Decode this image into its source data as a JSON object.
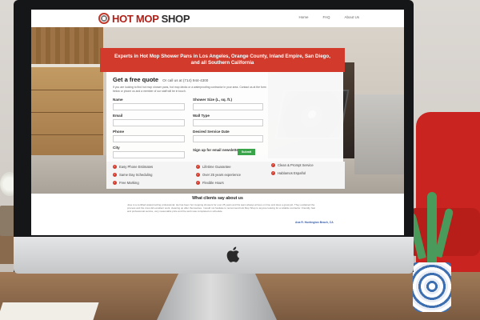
{
  "header": {
    "logo_hot": "HOT MOP",
    "logo_shop": "SHOP",
    "nav": [
      "Home",
      "FAQ",
      "About Us"
    ]
  },
  "hero": {
    "headline": "Experts in Hot Mop Shower Pans in Los Angeles, Orange County, Inland Empire, San Diego, and all Southern California"
  },
  "quote_form": {
    "title": "Get a free quote",
    "call": "Or call us at (714) 944-4300",
    "description": "If you are looking to find hot mop shower pans, hot mop decks or a waterproofing contractor in your area. Contact us at the form below or phone us and a member of our staff will be in touch.",
    "fields": {
      "name": "Name",
      "email": "Email",
      "phone": "Phone",
      "city": "City",
      "shower_size": "Shower Size (L, sq. ft.)",
      "wall_type": "Wall Type",
      "desired_date": "Desired Service Date"
    },
    "signup": "Sign up for email newsletter",
    "submit": "Submit"
  },
  "features": [
    "Easy Phone Estimates",
    "Lifetime Guarantee",
    "Clean & Prompt Service",
    "Same Day Scheduling",
    "Over 25 years experience",
    "Hablamos Español",
    "Free Marking",
    "Flexible Hours"
  ],
  "reviews": {
    "title": "What clients say about us",
    "text": "Jose is a certified waterproofing professional. He has been hot mopping showers for over 25 years and his team always arrives on time and does a great job. They explained the process and the crew did excellent work, cleaning up after themselves. I would not hesitate to recommend Hot Mop Shop to anyone looking for a reliable contractor. Friendly, fast and professional service, very reasonable price and the work was completed on schedule.",
    "author": "Ana R. Huntington Beach, CA"
  },
  "colors": {
    "brand_red": "#d23a2c",
    "submit_green": "#3aa44a"
  }
}
